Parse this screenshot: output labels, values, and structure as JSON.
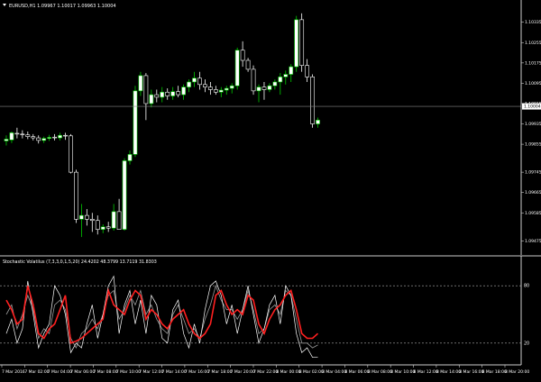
{
  "main_chart": {
    "header": "EURUSD,H1  1.09967 1.10017 1.09963 1.10004",
    "current_price": "1.10004",
    "price_labels": [
      "1.10335",
      "1.10255",
      "1.10175",
      "1.10095",
      "1.10015",
      "1.09935",
      "1.09855",
      "1.09745",
      "1.09665",
      "1.09585",
      "1.09475"
    ]
  },
  "indicator": {
    "header": "Stochastic Volatilus (7,3,3,0,1,5,20) 24.4202 48.3799 13.7119 31.8303",
    "levels": [
      "80",
      "20"
    ]
  },
  "time_axis": {
    "labels": [
      "7 Mar 2016",
      "7 Mar 02:00",
      "7 Mar 04:00",
      "7 Mar 06:00",
      "7 Mar 08:00",
      "7 Mar 10:00",
      "7 Mar 12:00",
      "7 Mar 14:00",
      "7 Mar 16:00",
      "7 Mar 18:00",
      "7 Mar 20:00",
      "7 Mar 22:00",
      "8 Mar 00:00",
      "8 Mar 02:00",
      "8 Mar 04:00",
      "8 Mar 06:00",
      "8 Mar 08:00",
      "8 Mar 10:00",
      "8 Mar 12:00",
      "8 Mar 14:00",
      "8 Mar 16:00",
      "8 Mar 18:00",
      "8 Mar 20:00"
    ]
  },
  "colors": {
    "background": "#000000",
    "bull_body": "#ffffff",
    "bear_body": "#000000",
    "bull_wick": "#00cc00",
    "bear_wick": "#ffffff",
    "axis_line": "#cccccc",
    "label_text": "#ffffff",
    "price_line": "#888888",
    "level_line": "#aaaaaa",
    "osc_red": "#ff2020",
    "osc_white": "#ffffff",
    "osc_gray": "#9a9a9a"
  },
  "chart_data": {
    "type": "candlestick",
    "candles": [
      {
        "o": 1.09868,
        "h": 1.0989,
        "l": 1.0985,
        "c": 1.09875
      },
      {
        "o": 1.09872,
        "h": 1.09905,
        "l": 1.0986,
        "c": 1.099
      },
      {
        "o": 1.09898,
        "h": 1.0992,
        "l": 1.09878,
        "c": 1.09895
      },
      {
        "o": 1.09895,
        "h": 1.0991,
        "l": 1.09878,
        "c": 1.09893
      },
      {
        "o": 1.09892,
        "h": 1.09905,
        "l": 1.09875,
        "c": 1.09885
      },
      {
        "o": 1.09885,
        "h": 1.09895,
        "l": 1.0987,
        "c": 1.0988
      },
      {
        "o": 1.0988,
        "h": 1.0989,
        "l": 1.09858,
        "c": 1.0987
      },
      {
        "o": 1.0987,
        "h": 1.09885,
        "l": 1.0986,
        "c": 1.09878
      },
      {
        "o": 1.09878,
        "h": 1.09892,
        "l": 1.09868,
        "c": 1.09882
      },
      {
        "o": 1.09883,
        "h": 1.09895,
        "l": 1.0987,
        "c": 1.0988
      },
      {
        "o": 1.0988,
        "h": 1.099,
        "l": 1.0987,
        "c": 1.0989
      },
      {
        "o": 1.0989,
        "h": 1.099,
        "l": 1.09872,
        "c": 1.09888
      },
      {
        "o": 1.09888,
        "h": 1.09895,
        "l": 1.0974,
        "c": 1.09745
      },
      {
        "o": 1.09745,
        "h": 1.09755,
        "l": 1.09545,
        "c": 1.0956
      },
      {
        "o": 1.0956,
        "h": 1.0962,
        "l": 1.0949,
        "c": 1.09575
      },
      {
        "o": 1.09575,
        "h": 1.096,
        "l": 1.09535,
        "c": 1.0956
      },
      {
        "o": 1.0956,
        "h": 1.09585,
        "l": 1.0951,
        "c": 1.09555
      },
      {
        "o": 1.09555,
        "h": 1.09575,
        "l": 1.095,
        "c": 1.0952
      },
      {
        "o": 1.0952,
        "h": 1.0954,
        "l": 1.09505,
        "c": 1.0953
      },
      {
        "o": 1.0953,
        "h": 1.0955,
        "l": 1.0951,
        "c": 1.09525
      },
      {
        "o": 1.09525,
        "h": 1.0962,
        "l": 1.09515,
        "c": 1.0959
      },
      {
        "o": 1.0959,
        "h": 1.0964,
        "l": 1.0958,
        "c": 1.0952
      },
      {
        "o": 1.0952,
        "h": 1.098,
        "l": 1.09515,
        "c": 1.0979
      },
      {
        "o": 1.0979,
        "h": 1.0983,
        "l": 1.09775,
        "c": 1.09815
      },
      {
        "o": 1.09815,
        "h": 1.10085,
        "l": 1.09805,
        "c": 1.10065
      },
      {
        "o": 1.10065,
        "h": 1.1014,
        "l": 1.10045,
        "c": 1.10125
      },
      {
        "o": 1.10125,
        "h": 1.10135,
        "l": 1.0995,
        "c": 1.10015
      },
      {
        "o": 1.10015,
        "h": 1.1007,
        "l": 1.1,
        "c": 1.1005
      },
      {
        "o": 1.1005,
        "h": 1.1007,
        "l": 1.1002,
        "c": 1.1004
      },
      {
        "o": 1.1004,
        "h": 1.1008,
        "l": 1.1002,
        "c": 1.1006
      },
      {
        "o": 1.1006,
        "h": 1.10075,
        "l": 1.1003,
        "c": 1.10045
      },
      {
        "o": 1.10045,
        "h": 1.1008,
        "l": 1.1003,
        "c": 1.10062
      },
      {
        "o": 1.10062,
        "h": 1.10085,
        "l": 1.1004,
        "c": 1.1005
      },
      {
        "o": 1.1005,
        "h": 1.1009,
        "l": 1.1003,
        "c": 1.1008
      },
      {
        "o": 1.1008,
        "h": 1.1011,
        "l": 1.1006,
        "c": 1.101
      },
      {
        "o": 1.101,
        "h": 1.1014,
        "l": 1.1008,
        "c": 1.10115
      },
      {
        "o": 1.10115,
        "h": 1.1014,
        "l": 1.1007,
        "c": 1.1009
      },
      {
        "o": 1.1009,
        "h": 1.1011,
        "l": 1.1006,
        "c": 1.1008
      },
      {
        "o": 1.1008,
        "h": 1.101,
        "l": 1.1005,
        "c": 1.1007
      },
      {
        "o": 1.1007,
        "h": 1.10085,
        "l": 1.1005,
        "c": 1.1006
      },
      {
        "o": 1.1006,
        "h": 1.1008,
        "l": 1.1004,
        "c": 1.10068
      },
      {
        "o": 1.10068,
        "h": 1.10085,
        "l": 1.1005,
        "c": 1.10075
      },
      {
        "o": 1.10075,
        "h": 1.10095,
        "l": 1.10055,
        "c": 1.10085
      },
      {
        "o": 1.10085,
        "h": 1.10235,
        "l": 1.1007,
        "c": 1.10225
      },
      {
        "o": 1.10225,
        "h": 1.1026,
        "l": 1.1016,
        "c": 1.10185
      },
      {
        "o": 1.10185,
        "h": 1.10195,
        "l": 1.1014,
        "c": 1.1015
      },
      {
        "o": 1.1015,
        "h": 1.10165,
        "l": 1.1005,
        "c": 1.10065
      },
      {
        "o": 1.10065,
        "h": 1.1009,
        "l": 1.1002,
        "c": 1.1008
      },
      {
        "o": 1.1008,
        "h": 1.101,
        "l": 1.1003,
        "c": 1.1007
      },
      {
        "o": 1.1007,
        "h": 1.10095,
        "l": 1.1006,
        "c": 1.10085
      },
      {
        "o": 1.10085,
        "h": 1.1011,
        "l": 1.1007,
        "c": 1.101
      },
      {
        "o": 1.101,
        "h": 1.10135,
        "l": 1.1005,
        "c": 1.1012
      },
      {
        "o": 1.1012,
        "h": 1.10145,
        "l": 1.1009,
        "c": 1.1013
      },
      {
        "o": 1.1013,
        "h": 1.1017,
        "l": 1.101,
        "c": 1.1016
      },
      {
        "o": 1.1016,
        "h": 1.1036,
        "l": 1.1014,
        "c": 1.10345
      },
      {
        "o": 1.10345,
        "h": 1.1037,
        "l": 1.1014,
        "c": 1.10165
      },
      {
        "o": 1.10165,
        "h": 1.1019,
        "l": 1.101,
        "c": 1.1012
      },
      {
        "o": 1.1012,
        "h": 1.1013,
        "l": 1.0992,
        "c": 1.09935
      },
      {
        "o": 1.09935,
        "h": 1.0996,
        "l": 1.0992,
        "c": 1.0995
      }
    ],
    "oscillator": {
      "range": [
        0,
        100
      ],
      "levels": [
        80,
        20
      ],
      "red": [
        65,
        55,
        40,
        45,
        80,
        60,
        30,
        25,
        35,
        40,
        55,
        70,
        20,
        22,
        25,
        30,
        35,
        40,
        45,
        75,
        60,
        55,
        50,
        65,
        75,
        70,
        45,
        55,
        50,
        40,
        35,
        45,
        50,
        55,
        40,
        30,
        25,
        30,
        40,
        70,
        75,
        60,
        50,
        55,
        50,
        70,
        65,
        40,
        30,
        45,
        55,
        60,
        70,
        75,
        55,
        30,
        25,
        25,
        30
      ],
      "white": [
        30,
        45,
        20,
        35,
        85,
        50,
        15,
        30,
        40,
        80,
        70,
        50,
        10,
        20,
        15,
        40,
        60,
        25,
        50,
        80,
        90,
        30,
        60,
        75,
        40,
        65,
        30,
        70,
        60,
        25,
        20,
        55,
        65,
        30,
        15,
        40,
        20,
        55,
        80,
        85,
        70,
        40,
        60,
        30,
        55,
        80,
        50,
        20,
        35,
        60,
        70,
        40,
        80,
        70,
        30,
        10,
        15,
        5,
        5
      ],
      "gray": [
        50,
        60,
        35,
        50,
        70,
        55,
        25,
        35,
        30,
        60,
        65,
        55,
        25,
        15,
        30,
        35,
        45,
        35,
        50,
        70,
        75,
        45,
        55,
        70,
        60,
        75,
        50,
        60,
        45,
        35,
        30,
        50,
        60,
        45,
        30,
        35,
        25,
        45,
        60,
        80,
        65,
        55,
        55,
        45,
        55,
        75,
        55,
        30,
        35,
        55,
        60,
        50,
        75,
        70,
        45,
        20,
        20,
        15,
        18
      ]
    }
  }
}
